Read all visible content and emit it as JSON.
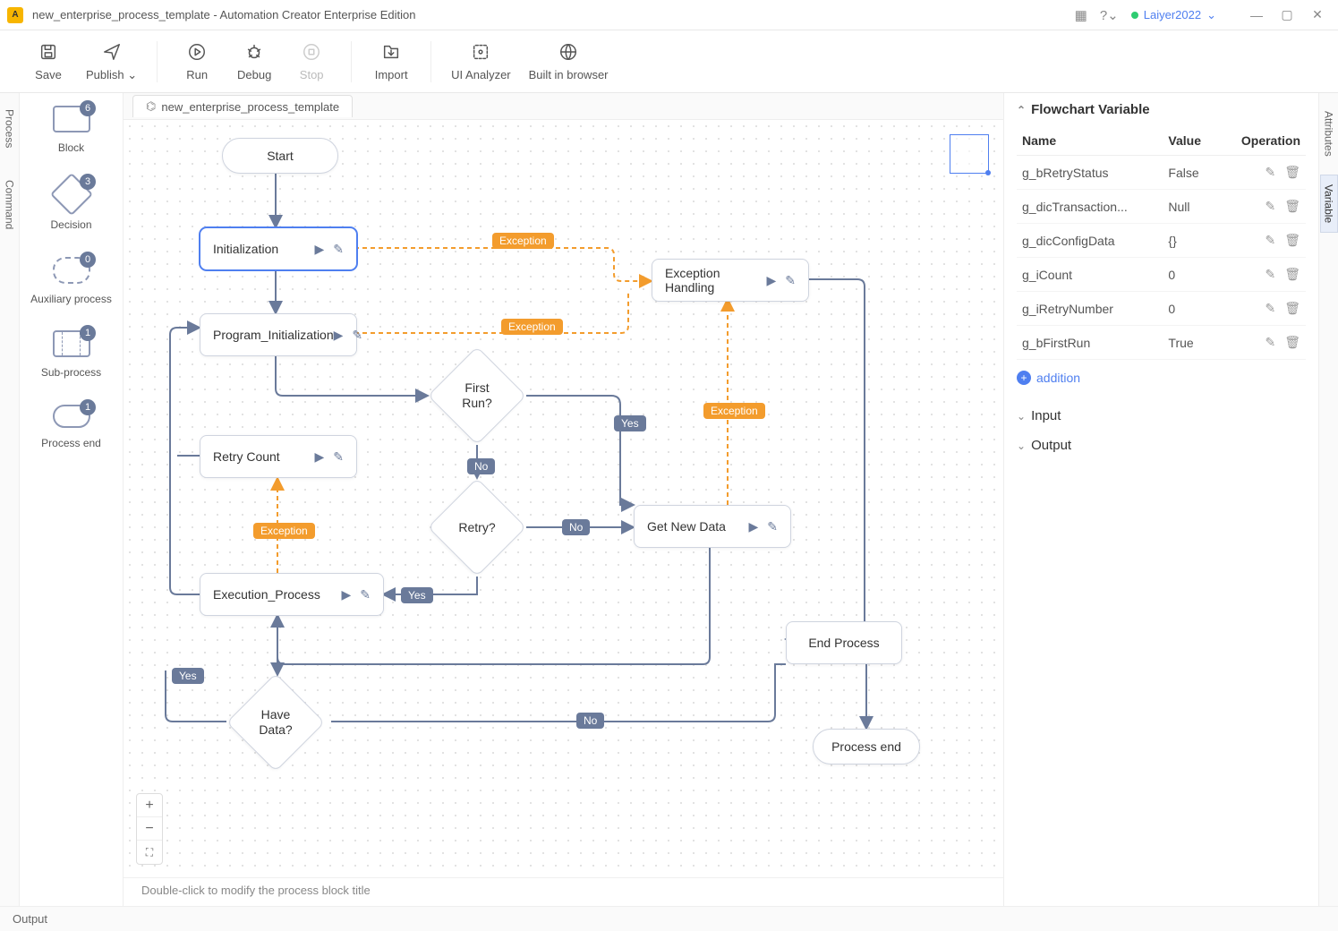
{
  "window": {
    "title": "new_enterprise_process_template - Automation Creator Enterprise Edition",
    "user": "Laiyer2022"
  },
  "toolbar": {
    "save": "Save",
    "publish": "Publish",
    "run": "Run",
    "debug": "Debug",
    "stop": "Stop",
    "import": "Import",
    "ui_analyzer": "UI Analyzer",
    "builtin_browser": "Built in browser"
  },
  "left_tabs": {
    "process": "Process",
    "command": "Command"
  },
  "right_tabs": {
    "attributes": "Attributes",
    "variable": "Variable"
  },
  "palette": {
    "block": {
      "label": "Block",
      "count": "6"
    },
    "decision": {
      "label": "Decision",
      "count": "3"
    },
    "aux": {
      "label": "Auxiliary process",
      "count": "0"
    },
    "sub": {
      "label": "Sub-process",
      "count": "1"
    },
    "end": {
      "label": "Process end",
      "count": "1"
    }
  },
  "tab": {
    "name": "new_enterprise_process_template"
  },
  "nodes": {
    "start": "Start",
    "initialization": "Initialization",
    "program_init": "Program_Initialization",
    "first_run": "First\nRun?",
    "retry_count": "Retry Count",
    "retry": "Retry?",
    "execution": "Execution_Process",
    "have_data": "Have\nData?",
    "get_new_data": "Get New Data",
    "exception_handling": "Exception Handling",
    "end_process": "End Process",
    "process_end": "Process end"
  },
  "edge_labels": {
    "exception": "Exception",
    "yes": "Yes",
    "no": "No"
  },
  "canvas_hint": "Double-click to modify the process block title",
  "right_panel": {
    "title": "Flowchart Variable",
    "headers": {
      "name": "Name",
      "value": "Value",
      "operation": "Operation"
    },
    "rows": [
      {
        "name": "g_bRetryStatus",
        "value": "False"
      },
      {
        "name": "g_dicTransaction...",
        "value": "Null"
      },
      {
        "name": "g_dicConfigData",
        "value": "{}"
      },
      {
        "name": "g_iCount",
        "value": "0"
      },
      {
        "name": "g_iRetryNumber",
        "value": "0"
      },
      {
        "name": "g_bFirstRun",
        "value": "True"
      }
    ],
    "addition": "addition",
    "input": "Input",
    "output": "Output"
  },
  "status": {
    "output": "Output"
  }
}
